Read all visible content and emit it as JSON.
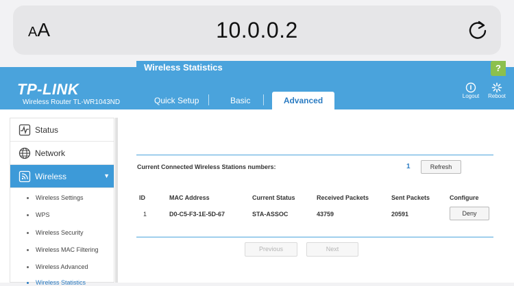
{
  "browser": {
    "aa_small": "A",
    "aa_big": "A",
    "url": "10.0.0.2"
  },
  "header": {
    "brand": "TP-LINK",
    "model": "Wireless Router TL-WR1043ND",
    "tabs": [
      "Quick Setup",
      "Basic",
      "Advanced"
    ],
    "logout": "Logout",
    "reboot": "Reboot"
  },
  "sidebar": {
    "items": [
      {
        "label": "Status",
        "icon": "status-icon"
      },
      {
        "label": "Network",
        "icon": "globe-icon"
      },
      {
        "label": "Wireless",
        "icon": "wireless-icon"
      }
    ],
    "subitems": [
      "Wireless Settings",
      "WPS",
      "Wireless Security",
      "Wireless MAC Filtering",
      "Wireless Advanced",
      "Wireless Statistics"
    ]
  },
  "content": {
    "title": "Wireless Statistics",
    "help": "?",
    "stations_label": "Current Connected Wireless Stations numbers:",
    "stations_count": "1",
    "refresh": "Refresh",
    "table": {
      "headers": [
        "ID",
        "MAC Address",
        "Current Status",
        "Received Packets",
        "Sent Packets",
        "Configure"
      ],
      "rows": [
        {
          "id": "1",
          "mac": "D0-C5-F3-1E-5D-67",
          "status": "STA-ASSOC",
          "received": "43759",
          "sent": "20591",
          "action": "Deny"
        }
      ]
    },
    "previous": "Previous",
    "next": "Next"
  },
  "colors": {
    "accent": "#4aa3dc",
    "sidebar_active": "#3d9ad8",
    "help": "#8cc04e"
  }
}
